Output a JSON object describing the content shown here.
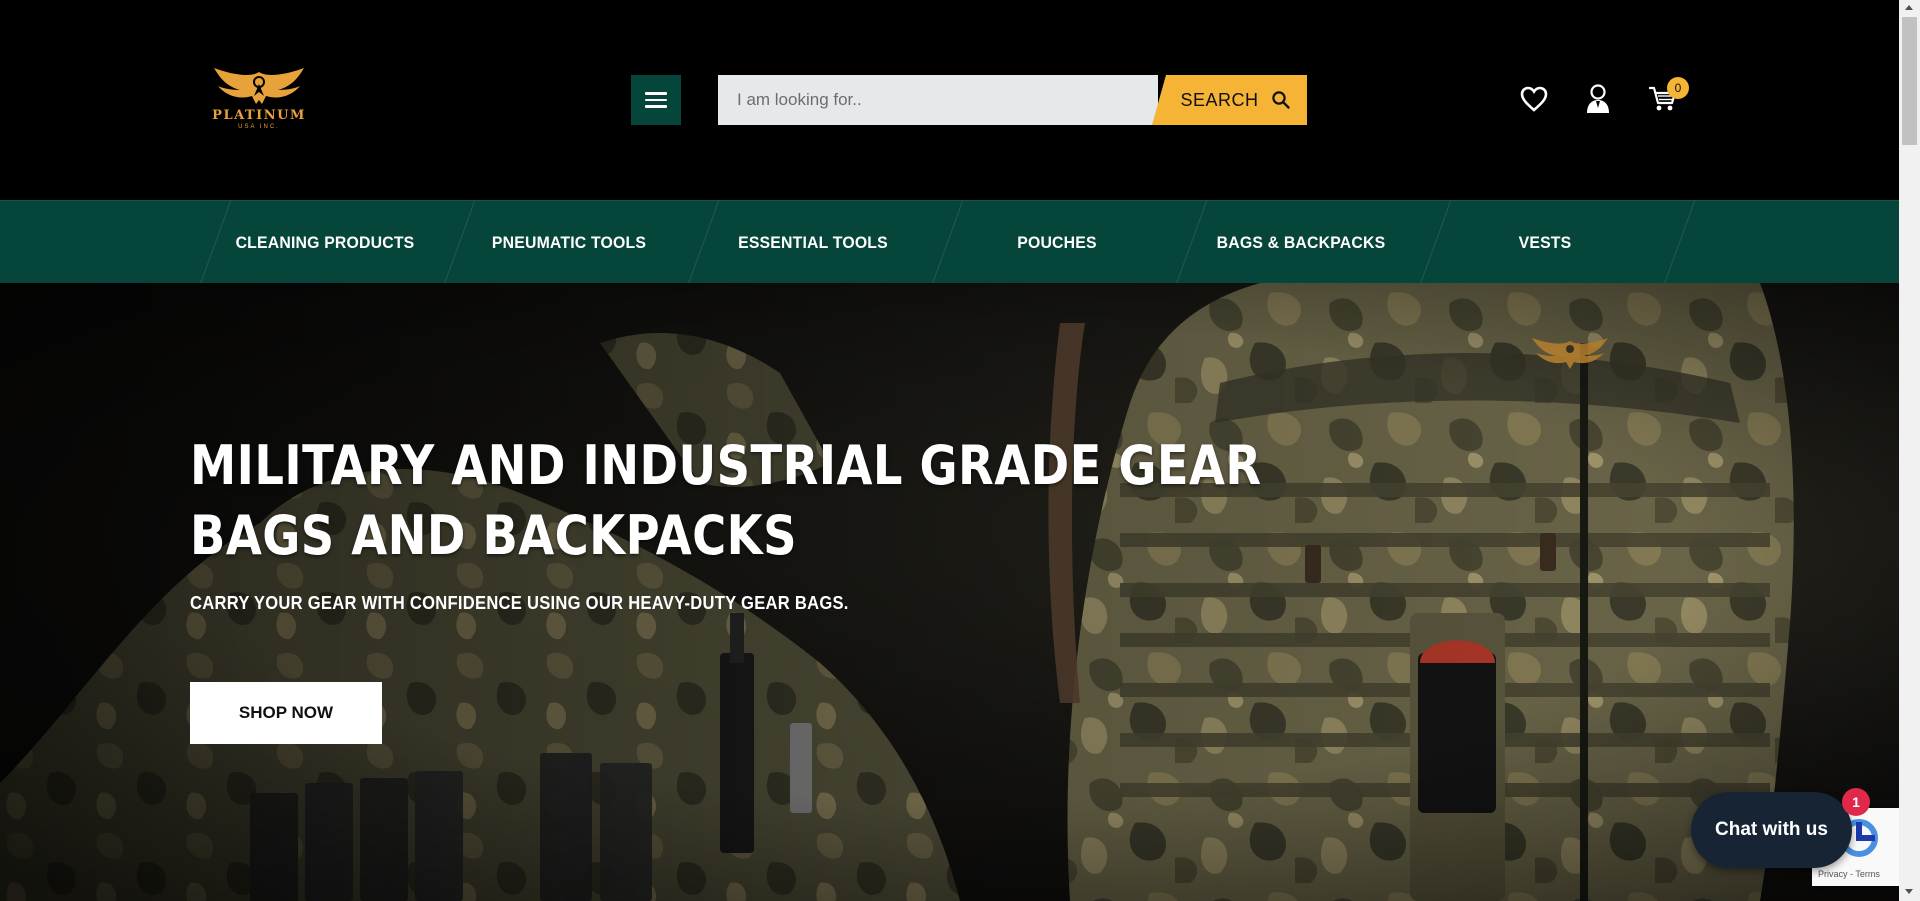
{
  "header": {
    "logo_text": "PLATINUM",
    "logo_sub": "USA INC.",
    "search_placeholder": "I am looking for..",
    "search_label": "SEARCH",
    "cart_count": "0",
    "icons": {
      "menu": "hamburger-menu-icon",
      "search": "search-icon",
      "wishlist": "heart-icon",
      "account": "user-icon",
      "cart": "shopping-cart-icon"
    }
  },
  "nav": {
    "items": [
      {
        "label": "CLEANING PRODUCTS"
      },
      {
        "label": "PNEUMATIC TOOLS"
      },
      {
        "label": "ESSENTIAL TOOLS"
      },
      {
        "label": "POUCHES"
      },
      {
        "label": "BAGS & BACKPACKS"
      },
      {
        "label": "VESTS"
      }
    ]
  },
  "hero": {
    "title_line1": "MILITARY AND INDUSTRIAL GRADE GEAR",
    "title_line2": "BAGS AND BACKPACKS",
    "subtitle": "CARRY YOUR GEAR WITH CONFIDENCE USING OUR HEAVY-DUTY GEAR BAGS.",
    "cta_label": "SHOP NOW"
  },
  "chat": {
    "label": "Chat with us",
    "badge": "1"
  },
  "recaptcha": {
    "text": "Privacy - Terms"
  },
  "colors": {
    "header_bg": "#000000",
    "nav_bg": "#06453a",
    "accent": "#f5b436",
    "chat_bg": "#172434",
    "badge_red": "#e0284a"
  }
}
